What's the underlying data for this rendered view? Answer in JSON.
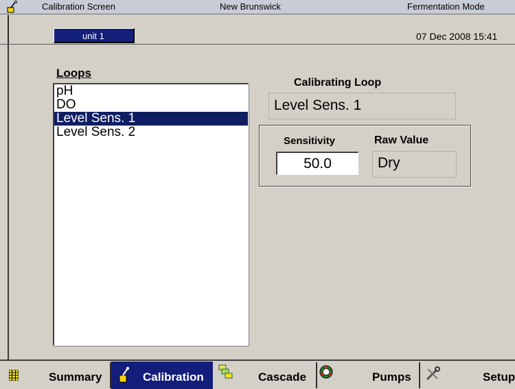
{
  "titlebar": {
    "screen_name": "Calibration Screen",
    "company": "New Brunswick",
    "mode": "Fermentation Mode",
    "icon": "pipette-icon"
  },
  "unitbar": {
    "unit_tab": "unit 1",
    "datetime": "07 Dec 2008  15:41"
  },
  "loops": {
    "label": "Loops",
    "items": [
      "pH",
      "DO",
      "Level Sens. 1",
      "Level Sens. 2"
    ],
    "selected_index": 2
  },
  "calibrating": {
    "label": "Calibrating Loop",
    "value": "Level Sens. 1"
  },
  "sensitivity": {
    "label": "Sensitivity",
    "value": "50.0"
  },
  "raw": {
    "label": "Raw Value",
    "value": "Dry"
  },
  "nav": {
    "summary": {
      "label": "Summary",
      "icon": "grid-icon"
    },
    "calibration": {
      "label": "Calibration",
      "icon": "pipette-icon"
    },
    "cascade": {
      "label": "Cascade",
      "icon": "cascade-icon"
    },
    "pumps": {
      "label": "Pumps",
      "icon": "pump-icon"
    },
    "setup": {
      "label": "Setup",
      "icon": "tools-icon"
    }
  },
  "colors": {
    "background": "#d4d0c8",
    "accent": "#131e7a",
    "selection": "#0f1d63"
  }
}
